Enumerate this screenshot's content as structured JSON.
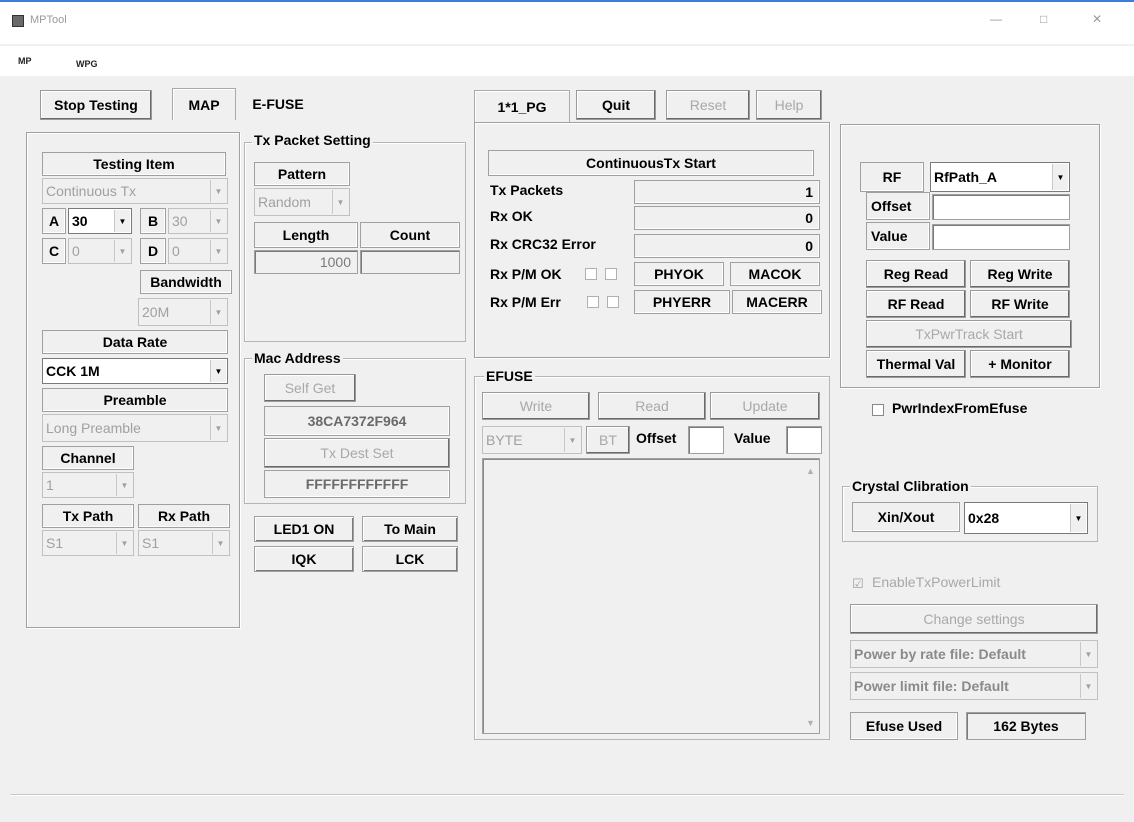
{
  "window": {
    "title": "MPTool",
    "minimize_icon": "minimize-icon",
    "maximize_icon": "maximize-icon",
    "close_icon": "close-icon"
  },
  "menu": {
    "items": [
      "MP",
      "WPG"
    ]
  },
  "top_buttons": {
    "stop_testing": "Stop Testing",
    "map_tab": "MAP",
    "efuse_tab": "E-FUSE"
  },
  "pg_buttons": {
    "pg_tab": "1*1_PG",
    "quit": "Quit",
    "reset": "Reset",
    "help": "Help"
  },
  "testing": {
    "title": "Testing Item",
    "mode": "Continuous Tx",
    "a_label": "A",
    "a_value": "30",
    "b_label": "B",
    "b_value": "30",
    "c_label": "C",
    "c_value": "0",
    "d_label": "D",
    "d_value": "0",
    "bandwidth_label": "Bandwidth",
    "bandwidth_value": "20M",
    "data_rate_label": "Data Rate",
    "data_rate_value": "CCK 1M",
    "preamble_label": "Preamble",
    "preamble_value": "Long Preamble",
    "channel_label": "Channel",
    "channel_value": "1",
    "tx_path_label": "Tx Path",
    "tx_path_value": "S1",
    "rx_path_label": "Rx Path",
    "rx_path_value": "S1"
  },
  "tx_packet": {
    "title": "Tx Packet Setting",
    "pattern_label": "Pattern",
    "pattern_value": "Random",
    "length_label": "Length",
    "length_value": "1000",
    "count_label": "Count",
    "count_value": ""
  },
  "mac": {
    "title": "Mac Address",
    "self_get": "Self Get",
    "self_addr": "38CA7372F964",
    "tx_dest_set": "Tx Dest Set",
    "dest_addr": "FFFFFFFFFFFF"
  },
  "misc_buttons": {
    "led": "LED1 ON",
    "to_main": "To Main",
    "iqk": "IQK",
    "lck": "LCK"
  },
  "status": {
    "header": "ContinuousTx Start",
    "tx_packets_label": "Tx Packets",
    "tx_packets_value": "1",
    "rx_ok_label": "Rx OK",
    "rx_ok_value": "0",
    "rx_crc_label": "Rx CRC32 Error",
    "rx_crc_value": "0",
    "rx_pm_ok_label": "Rx P/M OK",
    "phyok": "PHYOK",
    "macok": "MACOK",
    "rx_pm_err_label": "Rx P/M Err",
    "phyerr": "PHYERR",
    "macerr": "MACERR"
  },
  "efuse": {
    "title": "EFUSE",
    "write": "Write",
    "read": "Read",
    "update": "Update",
    "byte_value": "BYTE",
    "bt": "BT",
    "offset_label": "Offset",
    "offset_value": "",
    "value_label": "Value",
    "value_value": ""
  },
  "rf": {
    "rf_label": "RF",
    "rf_path": "RfPath_A",
    "offset_label": "Offset",
    "offset_value": "",
    "value_label": "Value",
    "value_value": "",
    "reg_read": "Reg Read",
    "reg_write": "Reg Write",
    "rf_read": "RF Read",
    "rf_write": "RF Write",
    "txpwr_track": "TxPwrTrack Start",
    "thermal_val": "Thermal Val",
    "monitor": "+ Monitor"
  },
  "pwr_index_from_efuse": "PwrIndexFromEfuse",
  "crystal": {
    "title": "Crystal Clibration",
    "label": "Xin/Xout",
    "value": "0x28"
  },
  "power_limit": {
    "enable_label": "EnableTxPowerLimit",
    "change_settings": "Change settings",
    "by_rate_file": "Power by rate file: Default",
    "limit_file": "Power limit file: Default"
  },
  "efuse_used": {
    "label": "Efuse Used",
    "value": "162 Bytes"
  },
  "colors": {
    "title_border": "#3c7fd8",
    "window_bg": "#f0f0f0",
    "disabled_text": "#a0a0a0"
  }
}
